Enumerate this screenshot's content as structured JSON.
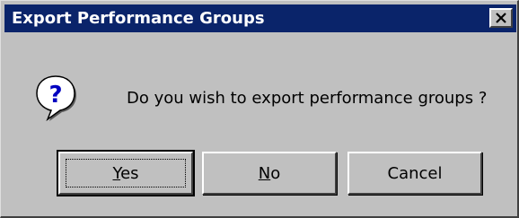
{
  "window": {
    "title": "Export Performance Groups",
    "close_label": "×"
  },
  "dialog": {
    "icon": "question-icon",
    "message": "Do you wish to export performance groups ?"
  },
  "buttons": {
    "yes": {
      "mnemonic": "Y",
      "rest": "es"
    },
    "no": {
      "mnemonic": "N",
      "rest": "o"
    },
    "cancel": {
      "label": "Cancel"
    }
  },
  "colors": {
    "titlebar": "#0a246a",
    "face": "#c0c0c0"
  }
}
